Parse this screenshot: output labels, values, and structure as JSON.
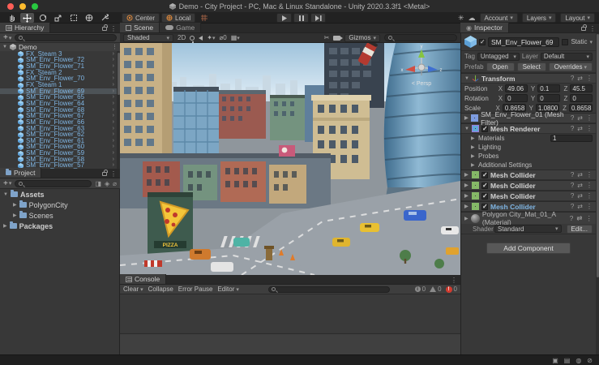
{
  "window": {
    "title": "Demo - City Project - PC, Mac & Linux Standalone - Unity 2020.3.3f1 <Metal>"
  },
  "toolbar": {
    "center": "Center",
    "local": "Local",
    "account": "Account",
    "layers": "Layers",
    "layout": "Layout"
  },
  "hierarchy": {
    "tab": "Hierarchy",
    "scene_name": "Demo",
    "selected_item": "SM_Env_Flower_69",
    "items": [
      "FX_Steam 3",
      "SM_Env_Flower_72",
      "SM_Env_Flower_71",
      "FX_Steam 2",
      "SM_Env_Flower_70",
      "FX_Steam 1",
      "SM_Env_Flower_69",
      "SM_Env_Flower_65",
      "SM_Env_Flower_64",
      "SM_Env_Flower_68",
      "SM_Env_Flower_67",
      "SM_Env_Flower_66",
      "SM_Env_Flower_63",
      "SM_Env_Flower_62",
      "SM_Env_Flower_61",
      "SM_Env_Flower_60",
      "SM_Env_Flower_59",
      "SM_Env_Flower_58",
      "SM_Env_Flower_57"
    ]
  },
  "project": {
    "tab": "Project",
    "tree": [
      "Assets",
      "PolygonCity",
      "Scenes",
      "Packages"
    ]
  },
  "scene_view": {
    "tab_scene": "Scene",
    "tab_game": "Game",
    "shaded": "Shaded",
    "label_2d": "2D",
    "hidden_count": "0",
    "gizmos": "Gizmos",
    "persp": "< Persp",
    "axis_x": "x",
    "axis_y": "y",
    "axis_z": "z",
    "pizza_text": "PIZZA"
  },
  "console": {
    "tab": "Console",
    "clear": "Clear",
    "collapse": "Collapse",
    "error_pause": "Error Pause",
    "editor": "Editor",
    "info_count": "0",
    "warning_count": "0",
    "error_count": "0"
  },
  "inspector": {
    "tab": "Inspector",
    "header": {
      "name": "SM_Env_Flower_69",
      "static_label": "Static"
    },
    "tag_row": {
      "tag_label": "Tag",
      "tag_value": "Untagged",
      "layer_label": "Layer",
      "layer_value": "Default"
    },
    "prefab_row": {
      "label": "Prefab",
      "open": "Open",
      "select": "Select",
      "overrides": "Overrides"
    },
    "transform": {
      "title": "Transform",
      "axis_labels": {
        "x": "X",
        "y": "Y",
        "z": "Z"
      },
      "rows": [
        {
          "label": "Position",
          "x": "49.06",
          "y": "0.1",
          "z": "45.5"
        },
        {
          "label": "Rotation",
          "x": "0",
          "y": "0",
          "z": "0"
        },
        {
          "label": "Scale",
          "x": "0.8658",
          "y": "1.0800",
          "z": "0.8658"
        }
      ]
    },
    "mesh_filter": {
      "name": "SM_Env_Flower_01 (Mesh Filter)"
    },
    "mesh_renderer": {
      "name": "Mesh Renderer",
      "rows": [
        {
          "label": "Materials",
          "value": "1"
        },
        {
          "label": "Lighting",
          "value": ""
        },
        {
          "label": "Probes",
          "value": ""
        },
        {
          "label": "Additional Settings",
          "value": ""
        }
      ]
    },
    "colliders": [
      "Mesh Collider",
      "Mesh Collider",
      "Mesh Collider",
      "Mesh Collider"
    ],
    "material": {
      "name": "Polygon City_Mat_01_A (Material)",
      "shader_label": "Shader",
      "shader_value": "Standard",
      "edit_label": "Edit..."
    },
    "add_component": "Add Component"
  },
  "colors": {
    "selection": "#4d5357",
    "prefab_text": "#7fb5e3",
    "error_badge": "#d23b2f",
    "axis_x": "#d04f43",
    "axis_y": "#86c440",
    "axis_z": "#3f6fd0"
  }
}
